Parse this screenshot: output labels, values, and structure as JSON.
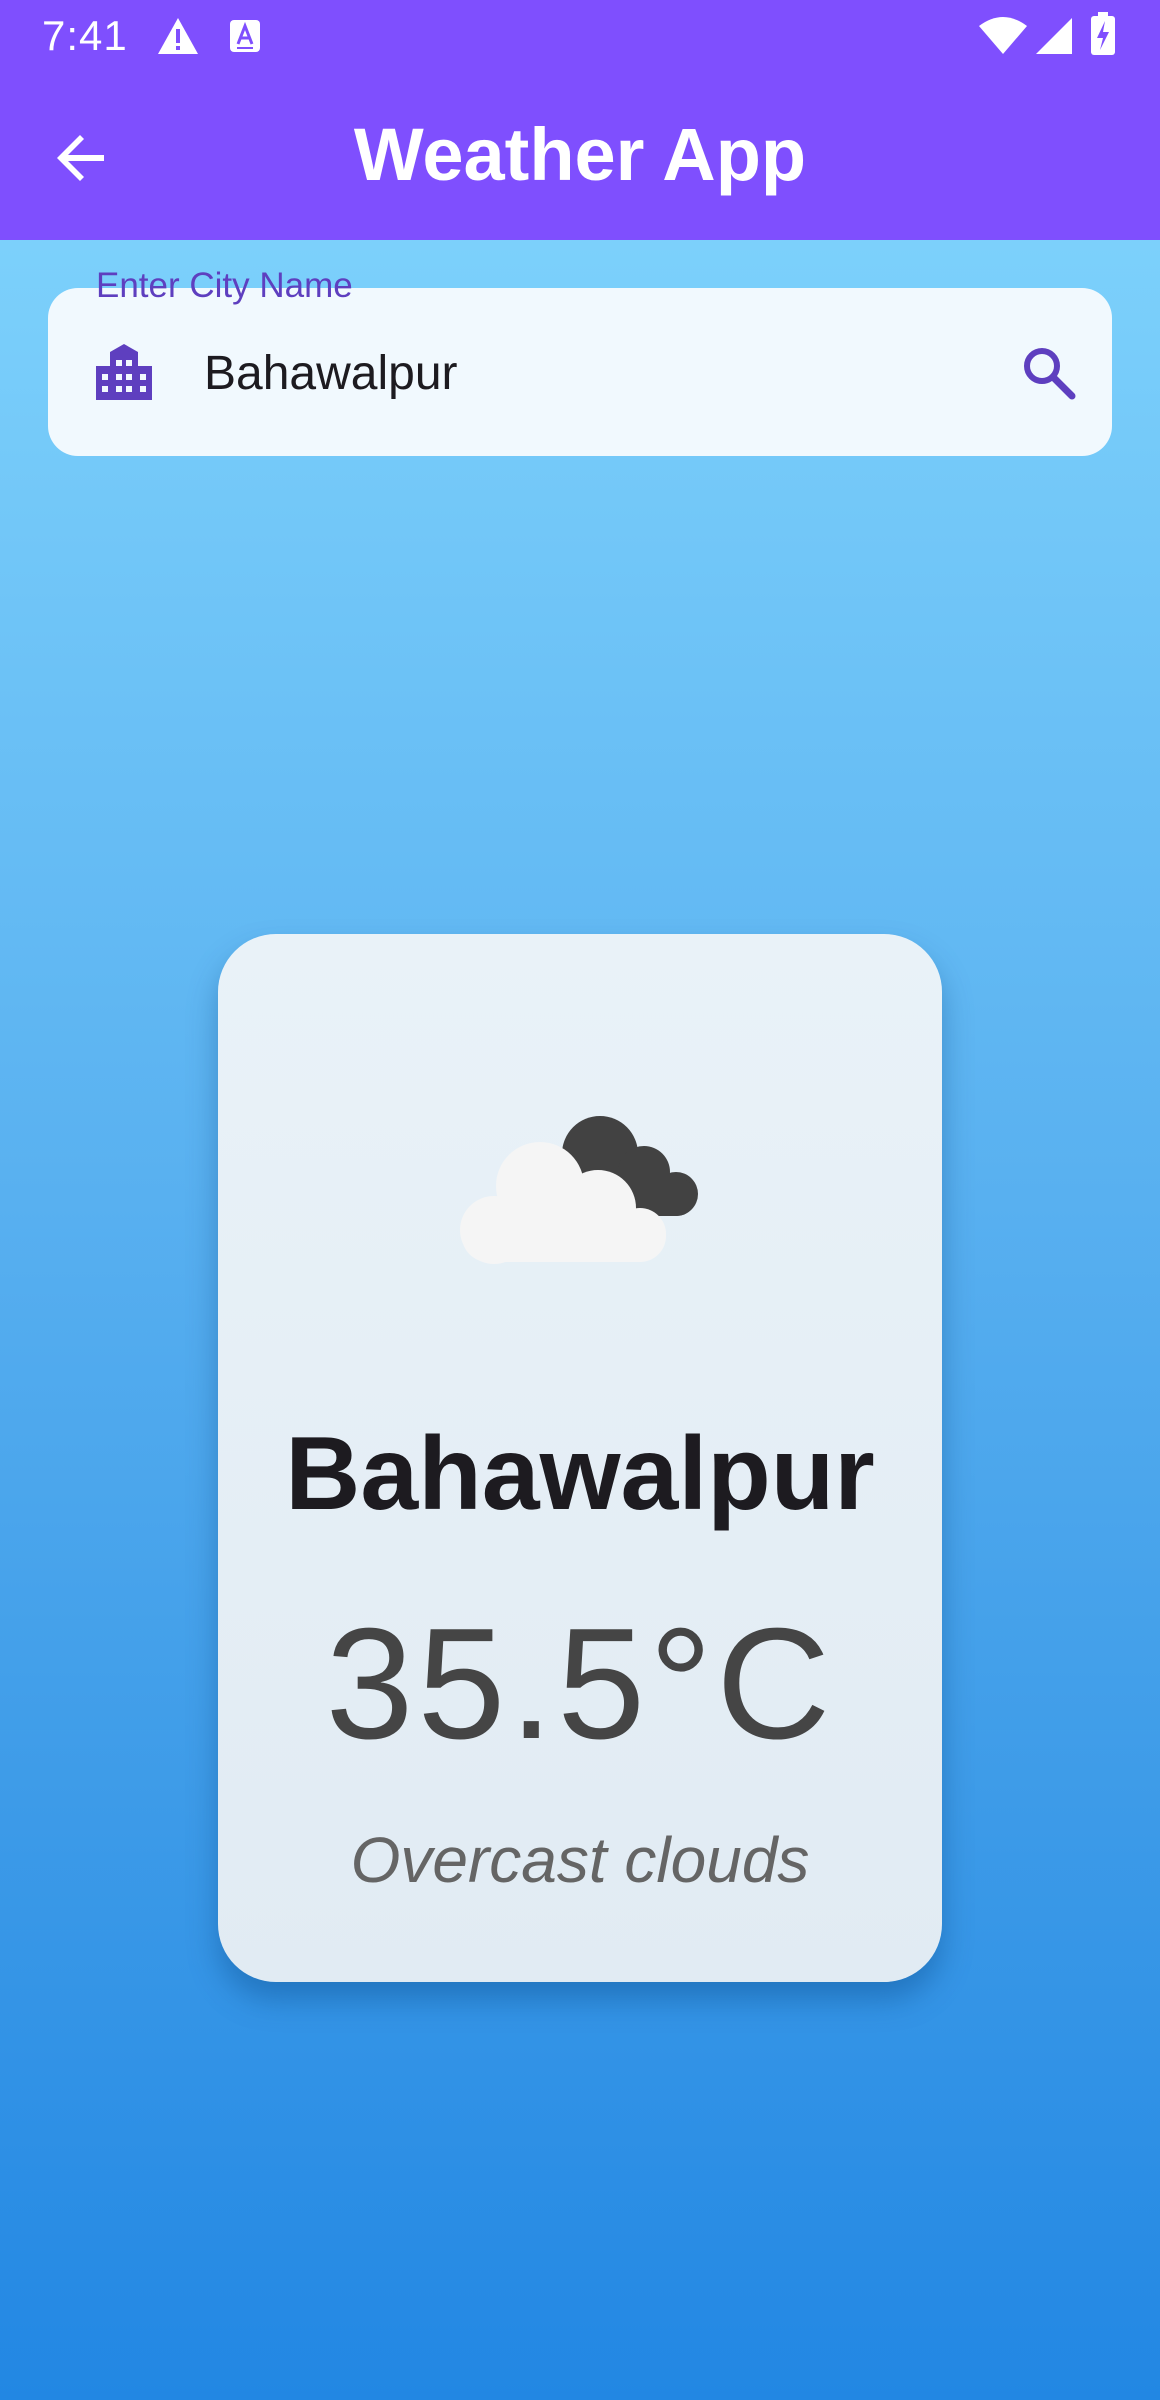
{
  "status_bar": {
    "time": "7:41",
    "icons": [
      "warning-icon",
      "keyboard-a-icon",
      "wifi-icon",
      "signal-icon",
      "battery-charging-icon"
    ]
  },
  "app_bar": {
    "back_icon": "arrow-back-icon",
    "title": "Weather App",
    "background": "#7f4ffe"
  },
  "search": {
    "label": "Enter City Name",
    "value": "Bahawalpur",
    "prefix_icon": "location-city-icon",
    "suffix_icon": "search-icon",
    "accent": "#5e3fbf"
  },
  "weather_card": {
    "icon": "overcast-clouds-icon",
    "city": "Bahawalpur",
    "temperature": "35.5°C",
    "description": "Overcast clouds"
  }
}
